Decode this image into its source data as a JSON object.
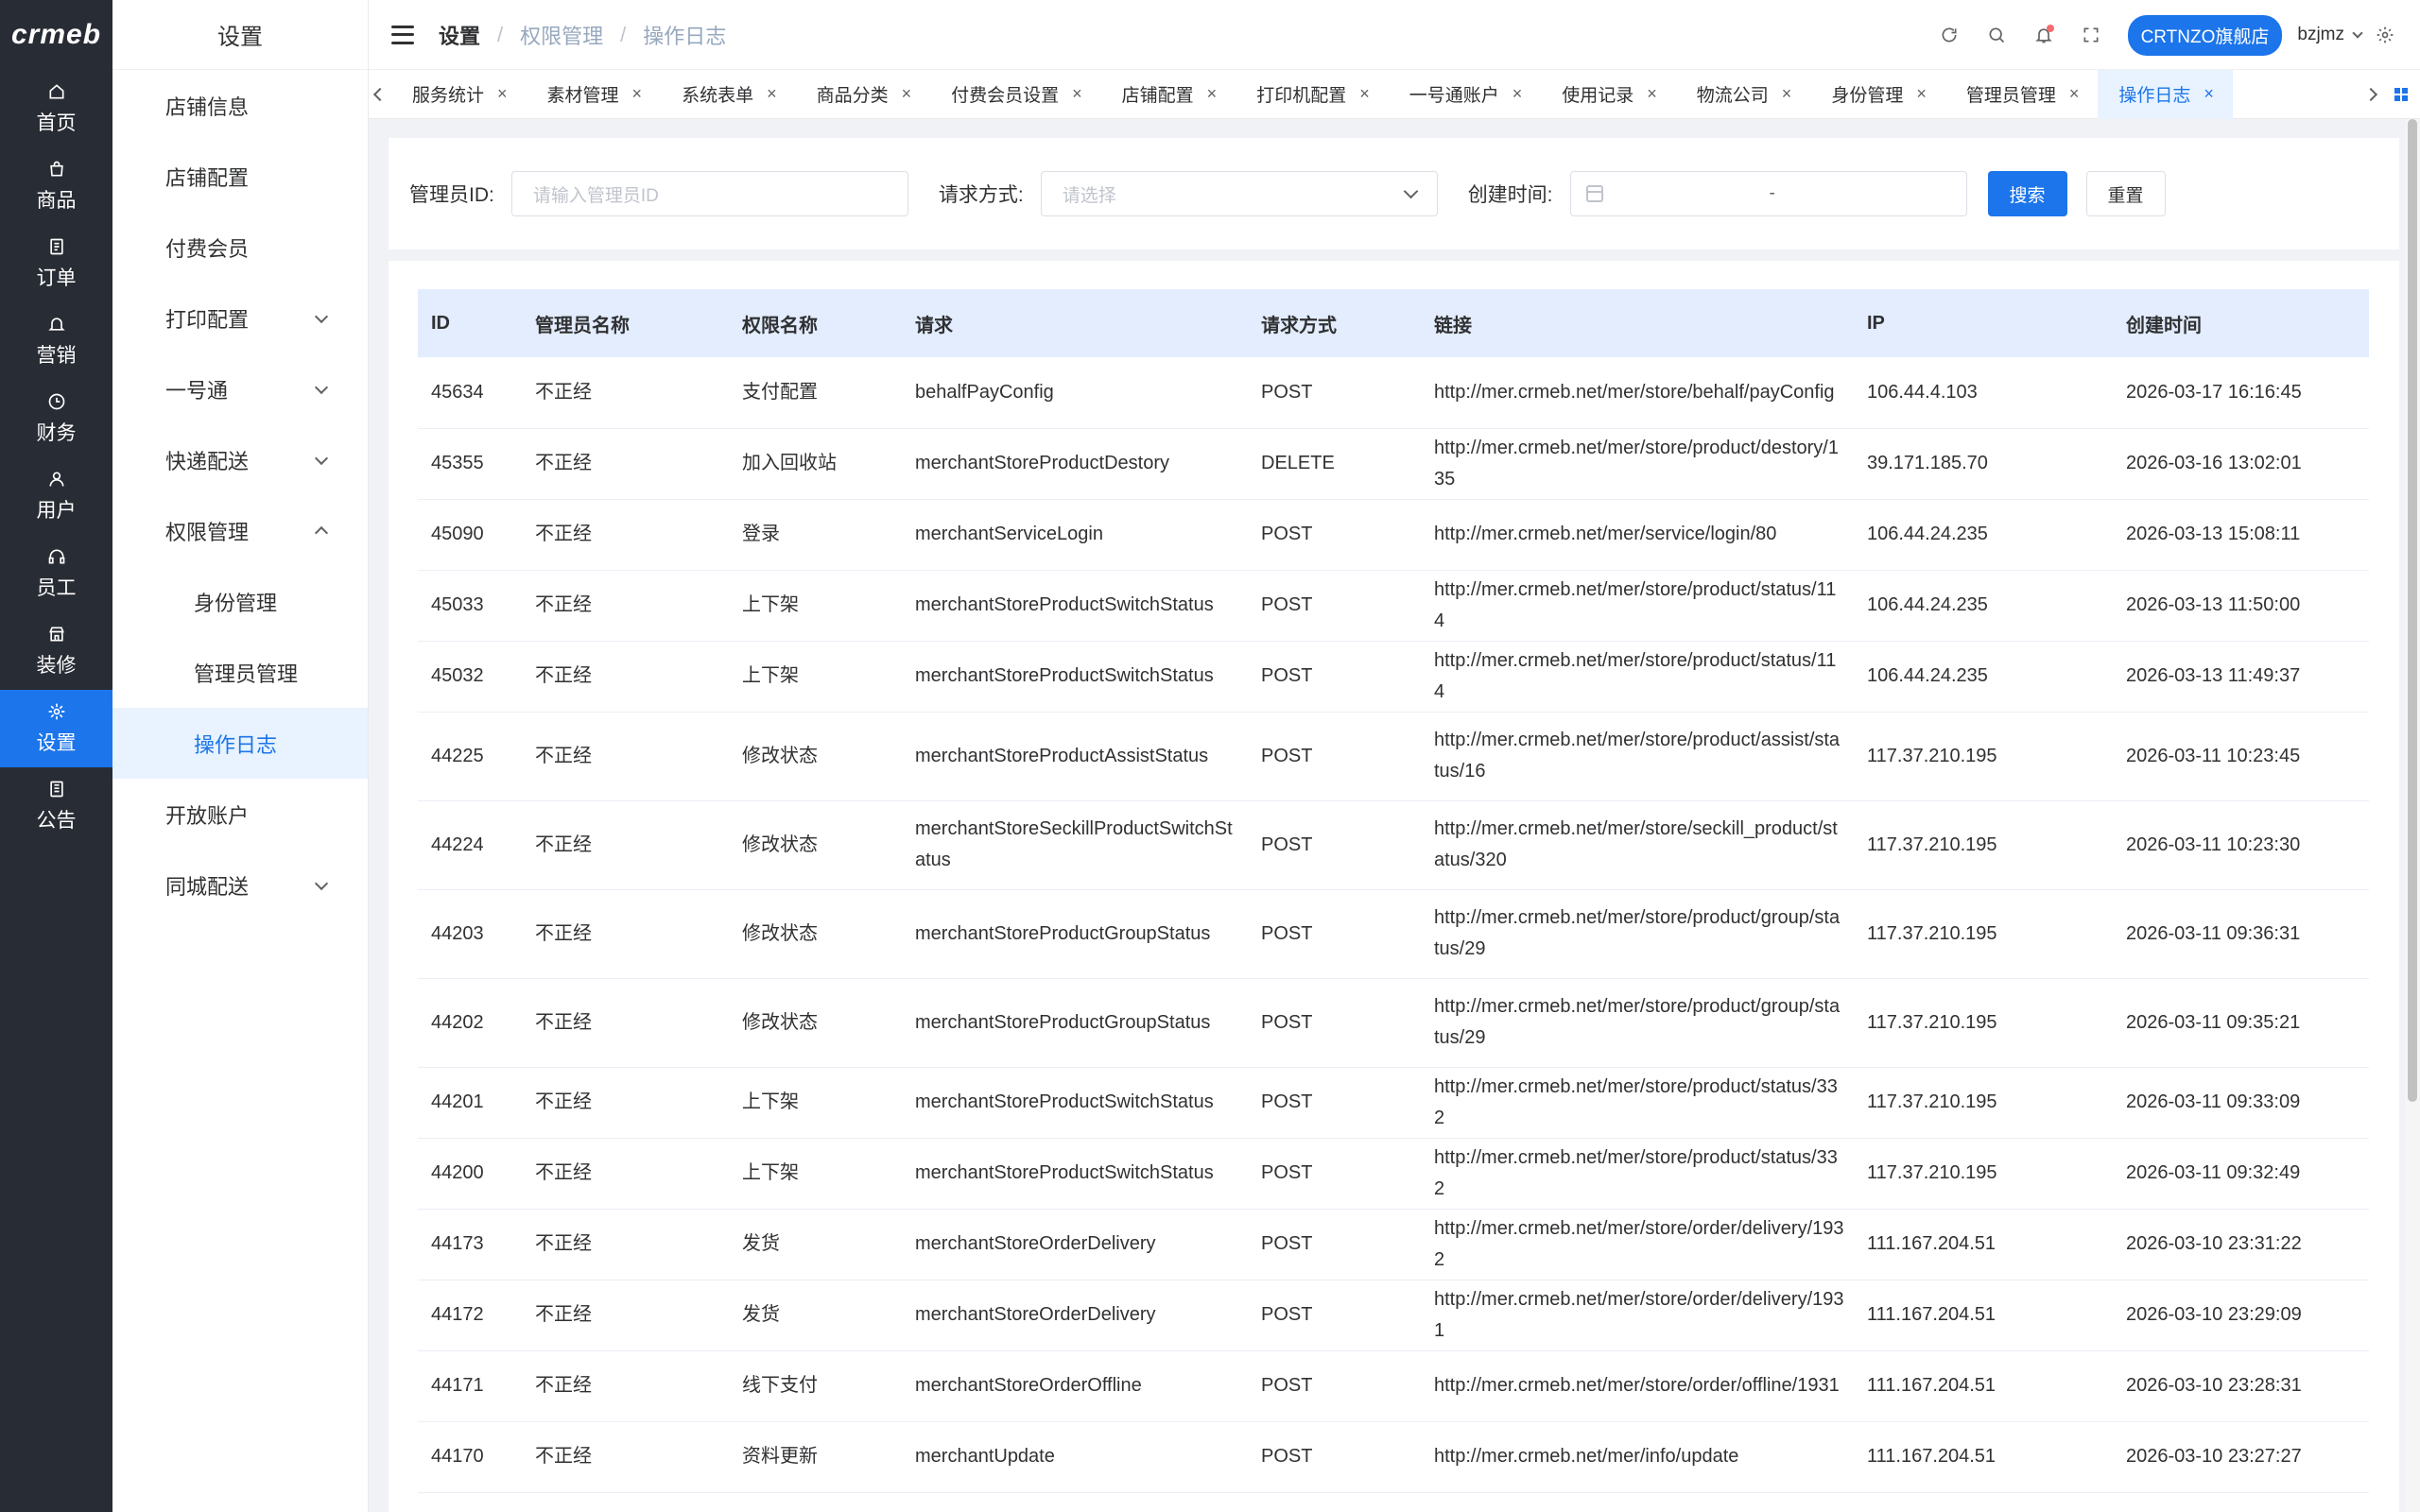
{
  "logo": "crmeb",
  "nav": [
    {
      "label": "首页",
      "icon": "home-icon"
    },
    {
      "label": "商品",
      "icon": "bag-icon"
    },
    {
      "label": "订单",
      "icon": "document-icon"
    },
    {
      "label": "营销",
      "icon": "bell-icon"
    },
    {
      "label": "财务",
      "icon": "clock-icon"
    },
    {
      "label": "用户",
      "icon": "user-icon"
    },
    {
      "label": "员工",
      "icon": "headset-icon"
    },
    {
      "label": "装修",
      "icon": "shop-icon"
    },
    {
      "label": "设置",
      "icon": "gear-icon",
      "active": true
    },
    {
      "label": "公告",
      "icon": "notice-icon"
    }
  ],
  "submenu": {
    "title": "设置",
    "items": [
      {
        "label": "店铺信息"
      },
      {
        "label": "店铺配置"
      },
      {
        "label": "付费会员"
      },
      {
        "label": "打印配置",
        "caret": "down"
      },
      {
        "label": "一号通",
        "caret": "down"
      },
      {
        "label": "快递配送",
        "caret": "down"
      },
      {
        "label": "权限管理",
        "caret": "up"
      },
      {
        "label": "身份管理",
        "child": true
      },
      {
        "label": "管理员管理",
        "child": true
      },
      {
        "label": "操作日志",
        "child": true,
        "active": true
      },
      {
        "label": "开放账户"
      },
      {
        "label": "同城配送",
        "caret": "down"
      }
    ]
  },
  "header": {
    "breadcrumb": [
      "设置",
      "权限管理",
      "操作日志"
    ],
    "store": "CRTNZO旗舰店",
    "user": "bzjmz"
  },
  "tabs": [
    {
      "label": "服务统计"
    },
    {
      "label": "素材管理"
    },
    {
      "label": "系统表单"
    },
    {
      "label": "商品分类"
    },
    {
      "label": "付费会员设置"
    },
    {
      "label": "店铺配置"
    },
    {
      "label": "打印机配置"
    },
    {
      "label": "一号通账户"
    },
    {
      "label": "使用记录"
    },
    {
      "label": "物流公司"
    },
    {
      "label": "身份管理"
    },
    {
      "label": "管理员管理"
    },
    {
      "label": "操作日志",
      "active": true
    }
  ],
  "filter": {
    "admin_label": "管理员ID:",
    "admin_placeholder": "请输入管理员ID",
    "method_label": "请求方式:",
    "method_placeholder": "请选择",
    "time_label": "创建时间:",
    "date_separator": "-",
    "search_btn": "搜索",
    "reset_btn": "重置"
  },
  "table": {
    "columns": [
      "ID",
      "管理员名称",
      "权限名称",
      "请求",
      "请求方式",
      "链接",
      "IP",
      "创建时间"
    ],
    "rows": [
      [
        "45634",
        "不正经",
        "支付配置",
        "behalfPayConfig",
        "POST",
        "http://mer.crmeb.net/mer/store/behalf/payConfig",
        "106.44.4.103",
        "2026-03-17 16:16:45"
      ],
      [
        "45355",
        "不正经",
        "加入回收站",
        "merchantStoreProductDestory",
        "DELETE",
        "http://mer.crmeb.net/mer/store/product/destory/135",
        "39.171.185.70",
        "2026-03-16 13:02:01"
      ],
      [
        "45090",
        "不正经",
        "登录",
        "merchantServiceLogin",
        "POST",
        "http://mer.crmeb.net/mer/service/login/80",
        "106.44.24.235",
        "2026-03-13 15:08:11"
      ],
      [
        "45033",
        "不正经",
        "上下架",
        "merchantStoreProductSwitchStatus",
        "POST",
        "http://mer.crmeb.net/mer/store/product/status/114",
        "106.44.24.235",
        "2026-03-13 11:50:00"
      ],
      [
        "45032",
        "不正经",
        "上下架",
        "merchantStoreProductSwitchStatus",
        "POST",
        "http://mer.crmeb.net/mer/store/product/status/114",
        "106.44.24.235",
        "2026-03-13 11:49:37"
      ],
      [
        "44225",
        "不正经",
        "修改状态",
        "merchantStoreProductAssistStatus",
        "POST",
        "http://mer.crmeb.net/mer/store/product/assist/status/16",
        "117.37.210.195",
        "2026-03-11 10:23:45"
      ],
      [
        "44224",
        "不正经",
        "修改状态",
        "merchantStoreSeckillProductSwitchStatus",
        "POST",
        "http://mer.crmeb.net/mer/store/seckill_product/status/320",
        "117.37.210.195",
        "2026-03-11 10:23:30"
      ],
      [
        "44203",
        "不正经",
        "修改状态",
        "merchantStoreProductGroupStatus",
        "POST",
        "http://mer.crmeb.net/mer/store/product/group/status/29",
        "117.37.210.195",
        "2026-03-11 09:36:31"
      ],
      [
        "44202",
        "不正经",
        "修改状态",
        "merchantStoreProductGroupStatus",
        "POST",
        "http://mer.crmeb.net/mer/store/product/group/status/29",
        "117.37.210.195",
        "2026-03-11 09:35:21"
      ],
      [
        "44201",
        "不正经",
        "上下架",
        "merchantStoreProductSwitchStatus",
        "POST",
        "http://mer.crmeb.net/mer/store/product/status/332",
        "117.37.210.195",
        "2026-03-11 09:33:09"
      ],
      [
        "44200",
        "不正经",
        "上下架",
        "merchantStoreProductSwitchStatus",
        "POST",
        "http://mer.crmeb.net/mer/store/product/status/332",
        "117.37.210.195",
        "2026-03-11 09:32:49"
      ],
      [
        "44173",
        "不正经",
        "发货",
        "merchantStoreOrderDelivery",
        "POST",
        "http://mer.crmeb.net/mer/store/order/delivery/1932",
        "111.167.204.51",
        "2026-03-10 23:31:22"
      ],
      [
        "44172",
        "不正经",
        "发货",
        "merchantStoreOrderDelivery",
        "POST",
        "http://mer.crmeb.net/mer/store/order/delivery/1931",
        "111.167.204.51",
        "2026-03-10 23:29:09"
      ],
      [
        "44171",
        "不正经",
        "线下支付",
        "merchantStoreOrderOffline",
        "POST",
        "http://mer.crmeb.net/mer/store/order/offline/1931",
        "111.167.204.51",
        "2026-03-10 23:28:31"
      ],
      [
        "44170",
        "不正经",
        "资料更新",
        "merchantUpdate",
        "POST",
        "http://mer.crmeb.net/mer/info/update",
        "111.167.204.51",
        "2026-03-10 23:27:27"
      ]
    ]
  },
  "colors": {
    "accent": "#1c75ea",
    "nav_bg": "#282c34",
    "table_header_bg": "#e3edfd"
  }
}
